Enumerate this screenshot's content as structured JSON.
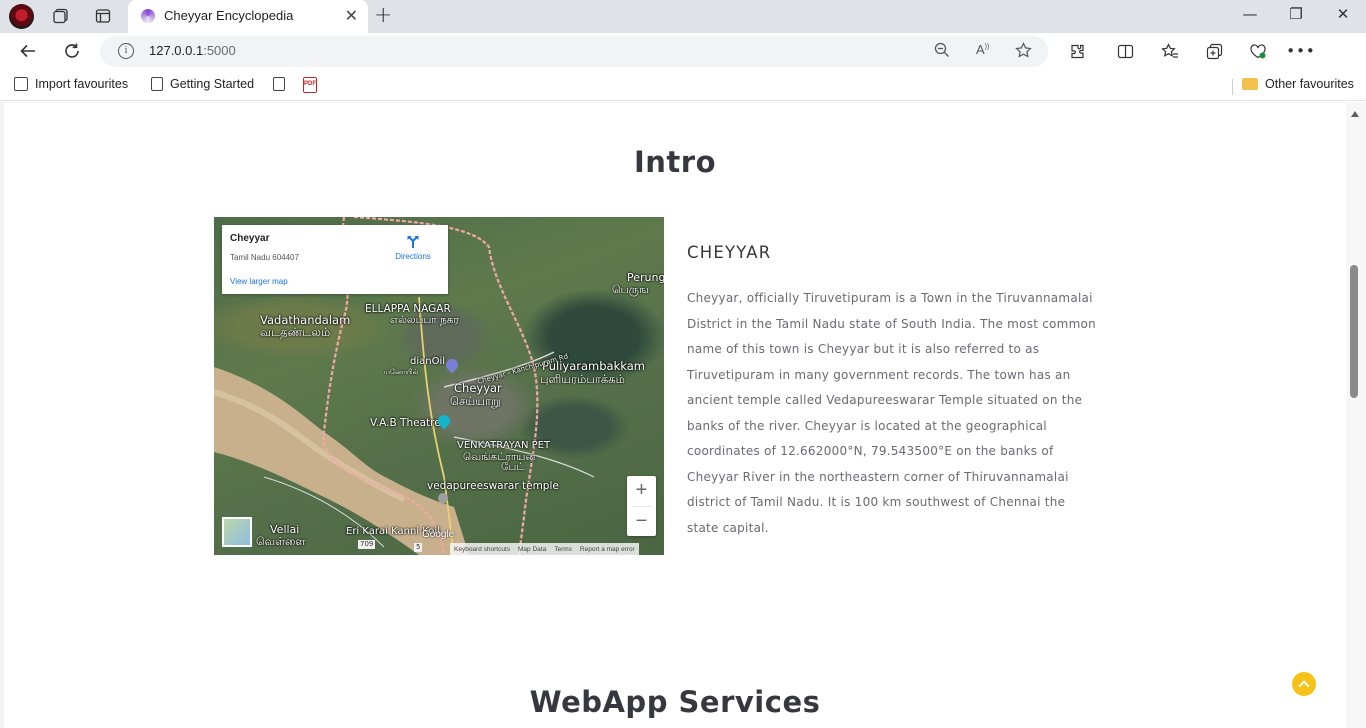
{
  "browser": {
    "tab_title": "Cheyyar Encyclopedia",
    "url_host": "127.0.0.1",
    "url_port": ":5000",
    "tab_close": "✕",
    "new_tab": "+",
    "window_controls": {
      "minimize": "—",
      "restore": "❐",
      "close": "✕"
    }
  },
  "favourites": {
    "items": [
      {
        "label": "Import favourites",
        "icon": "import-icon"
      },
      {
        "label": "Getting Started",
        "icon": "page-icon"
      },
      {
        "label": "",
        "icon": "page-icon"
      },
      {
        "label": "",
        "icon": "pdf-icon"
      }
    ],
    "other_label": "Other favourites"
  },
  "sections": {
    "intro_title": "Intro",
    "services_title": "WebApp Services"
  },
  "map": {
    "card": {
      "name": "Cheyyar",
      "address": "Tamil Nadu 604407",
      "larger_map_link": "View larger map",
      "directions_label": "Directions"
    },
    "labels": {
      "ellappa": "ELLAPPA NAGAR",
      "ellappa_ta": "எல்லப்பா நகர",
      "vadathandalam": "Vadathandalam",
      "vadathandalam_ta": "வடதண்டலம்",
      "perung": "Perung",
      "perung_ta": "பெருங",
      "dianoil": "dianOil",
      "dianoil_ta": "யனோயில்",
      "puliyarambakkam": "Puliyarambakkam",
      "puliyarambakkam_ta": "புளியரம்பாக்கம்",
      "cheyyar": "Cheyyar",
      "cheyyar_ta": "செய்யாறு",
      "road": "Cheyyar - Kanchipuram Rd",
      "vab": "V.A.B Theatre",
      "venkatrayan": "VENKATRAYAN PET",
      "venkatrayan_ta": "வெங்கட்ராயன",
      "venkatrayan_ta2": "பேட்",
      "temple": "vedapureeswarar temple",
      "vellai": "Vellai",
      "vellai_ta": "வெள்ளை",
      "eri": "Eri Karai Kanni Koil",
      "route": "709",
      "route2": "5"
    },
    "zoom_in": "+",
    "zoom_out": "−",
    "google": "Google",
    "attribution": [
      "Keyboard shortcuts",
      "Map Data",
      "Terms",
      "Report a map error"
    ]
  },
  "article": {
    "heading": "CHEYYAR",
    "body": "Cheyyar, officially Tiruvetipuram is a Town in the Tiruvannamalai District in the Tamil Nadu state of South India. The most common name of this town is Cheyyar but it is also referred to as Tiruvetipuram in many government records. The town has an ancient temple called Vedapureeswarar Temple situated on the banks of the river. Cheyyar is located at the geographical coordinates of 12.662000°N, 79.543500°E on the banks of Cheyyar River in the northeastern corner of Thiruvannamalai district of Tamil Nadu. It is 100 km southwest of Chennai the state capital."
  },
  "colors": {
    "accent": "#f6c217",
    "link": "#1a73e8",
    "heading": "#37373f",
    "body_text": "#6a6a72"
  }
}
